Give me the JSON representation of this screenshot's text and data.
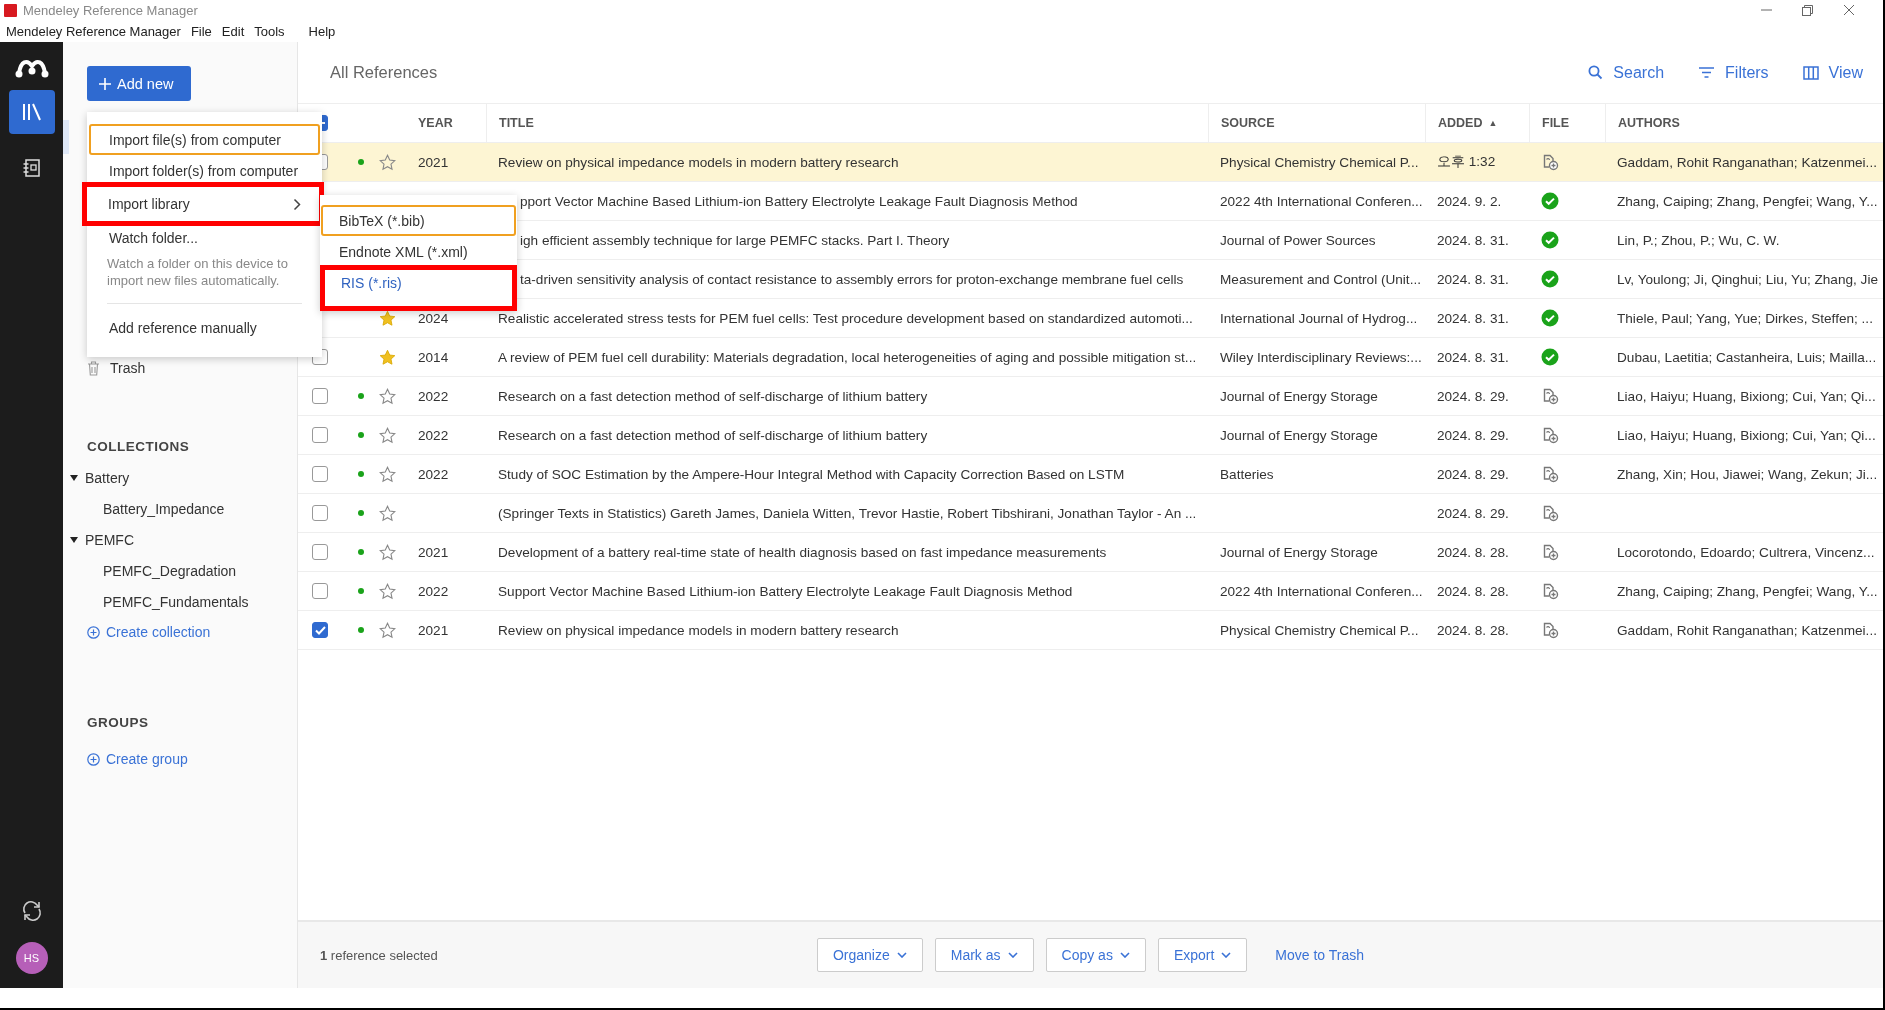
{
  "window": {
    "title": "Mendeley Reference Manager"
  },
  "menu_bar": [
    "Mendeley Reference Manager",
    "File",
    "Edit",
    "Tools",
    "Help"
  ],
  "rail": {
    "avatar": "HS"
  },
  "sidebar": {
    "add_button": "Add new",
    "trash": "Trash",
    "collections_heading": "COLLECTIONS",
    "collections": [
      {
        "label": "Battery",
        "expanded": true,
        "children": [
          {
            "label": "Battery_Impedance"
          }
        ]
      },
      {
        "label": "PEMFC",
        "expanded": true,
        "children": [
          {
            "label": "PEMFC_Degradation"
          },
          {
            "label": "PEMFC_Fundamentals"
          }
        ]
      }
    ],
    "create_collection": "Create collection",
    "groups_heading": "GROUPS",
    "create_group": "Create group"
  },
  "header": {
    "title": "All References",
    "tools": [
      {
        "kind": "search",
        "label": "Search"
      },
      {
        "kind": "filters",
        "label": "Filters"
      },
      {
        "kind": "view",
        "label": "View"
      }
    ]
  },
  "table": {
    "select_all": {
      "indeterminate": true
    },
    "columns": [
      {
        "label": "YEAR"
      },
      {
        "label": "TITLE"
      },
      {
        "label": "SOURCE"
      },
      {
        "label": "ADDED",
        "sort": "▲"
      },
      {
        "label": "FILE"
      },
      {
        "label": "AUTHORS"
      }
    ],
    "rows": [
      {
        "highlighted": true,
        "checked": false,
        "unread": true,
        "starred": false,
        "year": "2021",
        "title": "Review on physical impedance models in modern battery research",
        "source": "Physical Chemistry Chemical P...",
        "added": "오후 1:32",
        "file_attached": false,
        "authors": "Gaddam, Rohit Ranganathan; Katzenmei..."
      },
      {
        "highlighted": false,
        "title": "pport Vector Machine Based Lithium-ion Battery Electrolyte Leakage Fault Diagnosis Method",
        "source": "2022 4th International Conferen...",
        "added": "2024. 9. 2.",
        "file_attached": true,
        "authors": "Zhang, Caiping; Zhang, Pengfei; Wang, Y..."
      },
      {
        "highlighted": false,
        "title": "igh efficient assembly technique for large PEMFC stacks. Part I. Theory",
        "source": "Journal of Power Sources",
        "added": "2024. 8. 31.",
        "file_attached": true,
        "authors": "Lin, P.; Zhou, P.; Wu, C. W."
      },
      {
        "highlighted": false,
        "title": "ta-driven sensitivity analysis of contact resistance to assembly errors for proton-exchange membrane fuel cells",
        "source": "Measurement and Control (Unit...",
        "added": "2024. 8. 31.",
        "file_attached": true,
        "authors": "Lv, Youlong; Ji, Qinghui; Liu, Yu; Zhang, Jie"
      },
      {
        "highlighted": false,
        "unread": false,
        "starred": true,
        "year": "2024",
        "title": "Realistic accelerated stress tests for PEM fuel cells: Test procedure development based on standardized automoti...",
        "source": "International Journal of Hydrog...",
        "added": "2024. 8. 31.",
        "file_attached": true,
        "authors": "Thiele, Paul; Yang, Yue; Dirkes, Steffen; ..."
      },
      {
        "highlighted": false,
        "checked": false,
        "unread": false,
        "starred": true,
        "year": "2014",
        "title": "A review of PEM fuel cell durability: Materials degradation, local heterogeneities of aging and possible mitigation st...",
        "source": "Wiley Interdisciplinary Reviews:...",
        "added": "2024. 8. 31.",
        "file_attached": true,
        "authors": "Dubau, Laetitia; Castanheira, Luis; Mailla..."
      },
      {
        "highlighted": false,
        "checked": false,
        "unread": true,
        "starred": false,
        "year": "2022",
        "title": "Research on a fast detection method of self-discharge of lithium battery",
        "source": "Journal of Energy Storage",
        "added": "2024. 8. 29.",
        "file_attached": false,
        "authors": "Liao, Haiyu; Huang, Bixiong; Cui, Yan; Qi..."
      },
      {
        "highlighted": false,
        "checked": false,
        "unread": true,
        "starred": false,
        "year": "2022",
        "title": "Research on a fast detection method of self-discharge of lithium battery",
        "source": "Journal of Energy Storage",
        "added": "2024. 8. 29.",
        "file_attached": false,
        "authors": "Liao, Haiyu; Huang, Bixiong; Cui, Yan; Qi..."
      },
      {
        "highlighted": false,
        "checked": false,
        "unread": true,
        "starred": false,
        "year": "2022",
        "title": "Study of SOC Estimation by the Ampere-Hour Integral Method with Capacity Correction Based on LSTM",
        "source": "Batteries",
        "added": "2024. 8. 29.",
        "file_attached": false,
        "authors": "Zhang, Xin; Hou, Jiawei; Wang, Zekun; Ji..."
      },
      {
        "highlighted": false,
        "checked": false,
        "unread": true,
        "starred": false,
        "title": "(Springer Texts in Statistics) Gareth James, Daniela Witten, Trevor Hastie, Robert Tibshirani, Jonathan Taylor - An ...",
        "added": "2024. 8. 29.",
        "file_attached": false
      },
      {
        "highlighted": false,
        "checked": false,
        "unread": true,
        "starred": false,
        "year": "2021",
        "title": "Development of a battery real-time state of health diagnosis based on fast impedance measurements",
        "source": "Journal of Energy Storage",
        "added": "2024. 8. 28.",
        "file_attached": false,
        "authors": "Locorotondo, Edoardo; Cultrera, Vincenz..."
      },
      {
        "highlighted": false,
        "checked": false,
        "unread": true,
        "starred": false,
        "year": "2022",
        "title": "Support Vector Machine Based Lithium-ion Battery Electrolyte Leakage Fault Diagnosis Method",
        "source": "2022 4th International Conferen...",
        "added": "2024. 8. 28.",
        "file_attached": false,
        "authors": "Zhang, Caiping; Zhang, Pengfei; Wang, Y..."
      },
      {
        "highlighted": false,
        "checked": true,
        "unread": true,
        "starred": false,
        "year": "2021",
        "title": "Review on physical impedance models in modern battery research",
        "source": "Physical Chemistry Chemical P...",
        "added": "2024. 8. 28.",
        "file_attached": false,
        "authors": "Gaddam, Rohit Ranganathan; Katzenmei..."
      }
    ]
  },
  "footer": {
    "status": "**1** reference selected",
    "buttons": [
      "Organize",
      "Mark as",
      "Copy as",
      "Export"
    ],
    "link": "Move to Trash"
  },
  "add_menu": {
    "items": [
      {
        "kind": "action",
        "label": "Import file(s) from computer",
        "focused": true,
        "annotated": false
      },
      {
        "kind": "action",
        "label": "Import folder(s) from computer",
        "focused": false,
        "annotated": false
      },
      {
        "kind": "submenu",
        "label": "Import library",
        "focused": false,
        "annotated": true
      },
      {
        "kind": "described",
        "label": "Watch folder...",
        "description": "Watch a folder on this device to import new files automatically.",
        "focused": false,
        "annotated": false
      },
      {
        "kind": "divider"
      },
      {
        "kind": "action",
        "label": "Add reference manually",
        "focused": false,
        "annotated": false
      }
    ]
  },
  "submenu": {
    "items": [
      {
        "label": "BibTeX (*.bib)",
        "focused": true,
        "hovered": false,
        "annotated": false
      },
      {
        "label": "Endnote XML (*.xml)",
        "focused": false,
        "hovered": false,
        "annotated": false
      },
      {
        "label": "RIS (*.ris)",
        "focused": false,
        "hovered": true,
        "annotated": true
      }
    ]
  }
}
